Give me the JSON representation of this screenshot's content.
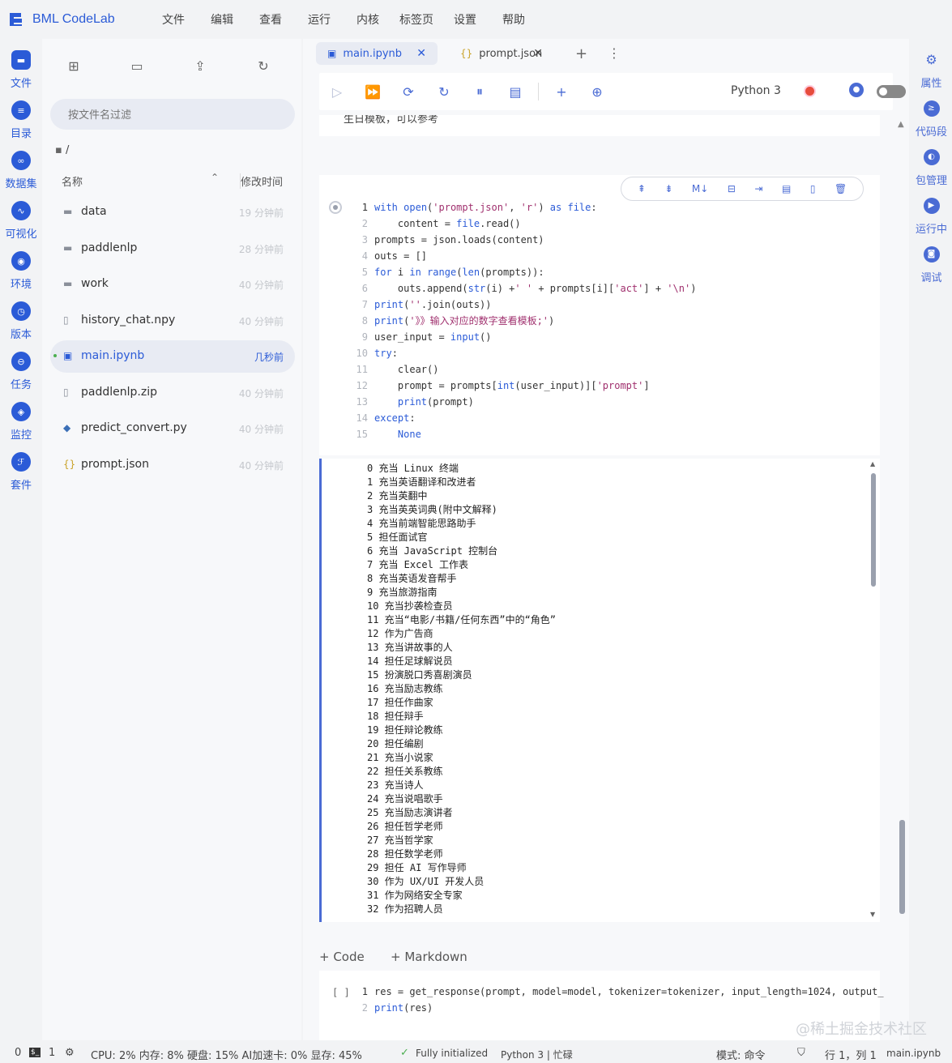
{
  "app": {
    "logo": "BML CodeLab"
  },
  "menu": [
    "文件",
    "编辑",
    "查看",
    "运行",
    "内核",
    "标签页",
    "设置",
    "帮助"
  ],
  "activity": [
    {
      "label": "文件",
      "icon": "folder-icon"
    },
    {
      "label": "目录",
      "icon": "list-icon"
    },
    {
      "label": "数据集",
      "icon": "dataset-icon"
    },
    {
      "label": "可视化",
      "icon": "chart-icon"
    },
    {
      "label": "环境",
      "icon": "env-icon"
    },
    {
      "label": "版本",
      "icon": "clock-icon"
    },
    {
      "label": "任务",
      "icon": "task-icon"
    },
    {
      "label": "监控",
      "icon": "monitor-icon"
    },
    {
      "label": "套件",
      "icon": "suite-icon"
    }
  ],
  "filepanel": {
    "filter_placeholder": "按文件名过滤",
    "path": "/",
    "col_name": "名称",
    "col_time": "修改时间",
    "files": [
      {
        "name": "data",
        "time": "19 分钟前",
        "type": "folder"
      },
      {
        "name": "paddlenlp",
        "time": "28 分钟前",
        "type": "folder"
      },
      {
        "name": "work",
        "time": "40 分钟前",
        "type": "folder"
      },
      {
        "name": "history_chat.npy",
        "time": "40 分钟前",
        "type": "file"
      },
      {
        "name": "main.ipynb",
        "time": "几秒前",
        "type": "notebook"
      },
      {
        "name": "paddlenlp.zip",
        "time": "40 分钟前",
        "type": "file"
      },
      {
        "name": "predict_convert.py",
        "time": "40 分钟前",
        "type": "python"
      },
      {
        "name": "prompt.json",
        "time": "40 分钟前",
        "type": "json"
      }
    ]
  },
  "tabs": [
    {
      "label": "main.ipynb"
    },
    {
      "label": "prompt.json"
    }
  ],
  "kernel": {
    "name": "Python 3"
  },
  "prev_cell_text": "生日模板，可以参考",
  "cell1_lines": [
    "with open('prompt.json', 'r') as file:",
    "    content = file.read()",
    "prompts = json.loads(content)",
    "outs = []",
    "for i in range(len(prompts)):",
    "    outs.append(str(i) +' ' + prompts[i]['act'] + '\\n')",
    "print(''.join(outs))",
    "print('》》输入对应的数字查看模板;')",
    "user_input = input()",
    "try:",
    "    clear()",
    "    prompt = prompts[int(user_input)]['prompt']",
    "    print(prompt)",
    "except:",
    "    None"
  ],
  "output_lines": [
    "0 充当 Linux 终端",
    "1 充当英语翻译和改进者",
    "2 充当英翻中",
    "3 充当英英词典(附中文解释)",
    "4 充当前端智能思路助手",
    "5 担任面试官",
    "6 充当 JavaScript 控制台",
    "7 充当 Excel 工作表",
    "8 充当英语发音帮手",
    "9 充当旅游指南",
    "10 充当抄袭检查员",
    "11 充当“电影/书籍/任何东西”中的“角色”",
    "12 作为广告商",
    "13 充当讲故事的人",
    "14 担任足球解说员",
    "15 扮演脱口秀喜剧演员",
    "16 充当励志教练",
    "17 担任作曲家",
    "18 担任辩手",
    "19 担任辩论教练",
    "20 担任编剧",
    "21 充当小说家",
    "22 担任关系教练",
    "23 充当诗人",
    "24 充当说唱歌手",
    "25 充当励志演讲者",
    "26 担任哲学老师",
    "27 充当哲学家",
    "28 担任数学老师",
    "29 担任 AI 写作导师",
    "30 作为 UX/UI 开发人员",
    "31 作为网络安全专家",
    "32 作为招聘人员"
  ],
  "add_code": "+ Code",
  "add_markdown": "+ Markdown",
  "cell2_lines": [
    "res = get_response(prompt, model=model, tokenizer=tokenizer, input_length=1024, output_",
    "print(res)"
  ],
  "cell2_bracket": "[ ]",
  "right": [
    {
      "label": "属性",
      "icon": "settings-icon"
    },
    {
      "label": "代码段",
      "icon": "code-icon"
    },
    {
      "label": "包管理",
      "icon": "package-icon"
    },
    {
      "label": "运行中",
      "icon": "running-icon"
    },
    {
      "label": "调试",
      "icon": "debug-icon"
    }
  ],
  "status": {
    "zero": "0",
    "one": "1",
    "resources": "CPU: 2% 内存: 8% 硬盘: 15% AI加速卡: 0% 显存: 45%",
    "init": "Fully initialized",
    "kernel": "Python 3 | 忙碌",
    "mode": "模式: 命令",
    "pos": "行 1，列 1",
    "file": "main.ipynb"
  },
  "watermark": "@稀土掘金技术社区"
}
